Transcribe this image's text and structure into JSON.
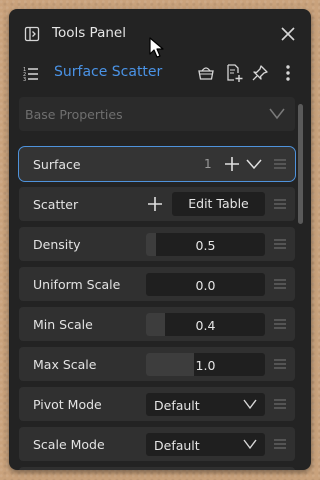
{
  "window": {
    "title": "Tools Panel"
  },
  "header": {
    "subtitle": "Surface Scatter"
  },
  "section": {
    "label": "Base Properties"
  },
  "rows": {
    "surface": {
      "label": "Surface",
      "count": "1"
    },
    "scatter": {
      "label": "Scatter",
      "button": "Edit Table"
    },
    "density": {
      "label": "Density",
      "value": "0.5",
      "fill": 0.08
    },
    "uniform_scale": {
      "label": "Uniform Scale",
      "value": "0.0",
      "fill": 0.0
    },
    "min_scale": {
      "label": "Min Scale",
      "value": "0.4",
      "fill": 0.16
    },
    "max_scale": {
      "label": "Max Scale",
      "value": "1.0",
      "fill": 0.4
    },
    "pivot_mode": {
      "label": "Pivot Mode",
      "value": "Default"
    },
    "scale_mode": {
      "label": "Scale Mode",
      "value": "Default"
    }
  },
  "colors": {
    "accent": "#4a93e6",
    "panel": "#232323",
    "row": "#303030",
    "field": "#1f1f1f",
    "selected_outline": "#4f93dc"
  },
  "icons": [
    "panel-icon",
    "close-icon",
    "list-icon",
    "basket-icon",
    "add-document-icon",
    "pin-icon",
    "more-vertical-icon",
    "chevron-down-icon",
    "plus-icon",
    "drag-handle-icon",
    "mouse-cursor-icon"
  ]
}
